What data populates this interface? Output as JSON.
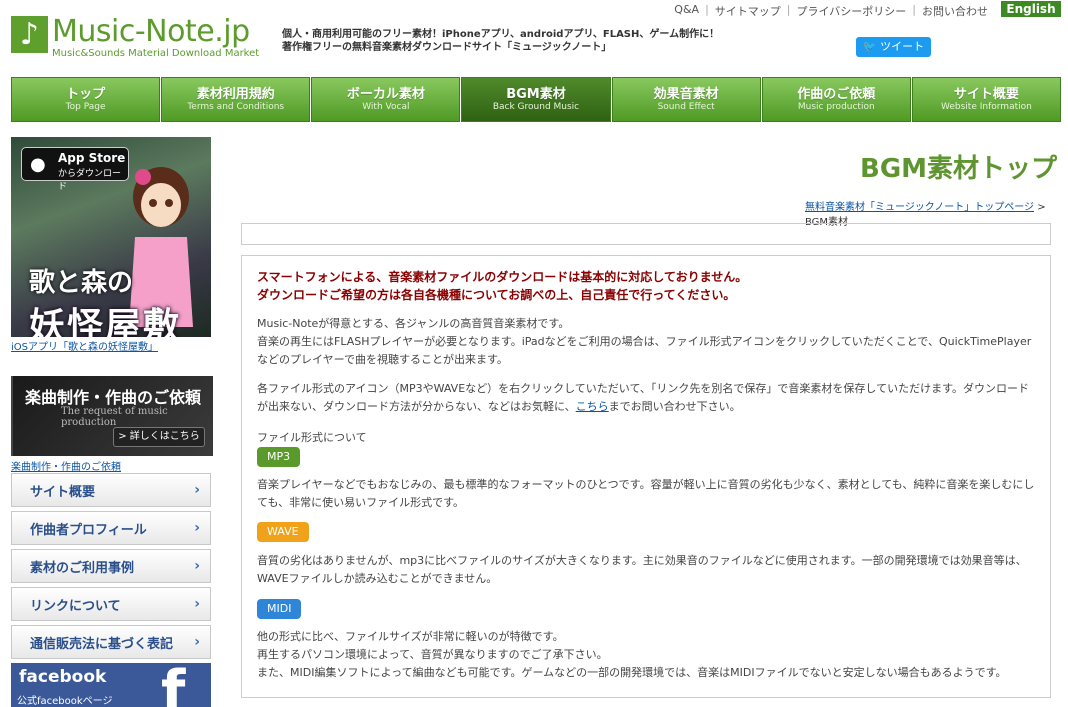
{
  "header": {
    "logo_mark": "♪",
    "logo_title": "Music-Note.jp",
    "logo_sub": "Music&Sounds Material Download Market",
    "tagline1": "個人・商用利用可能のフリー素材！iPhoneアプリ、androidアプリ、FLASH、ゲーム制作に！",
    "tagline2": "著作権フリーの無料音楽素材ダウンロードサイト「ミュージックノート」",
    "top_links": [
      "Q&A",
      "サイトマップ",
      "プライバシーポリシー",
      "お問い合わせ"
    ],
    "lang": "English",
    "tweet": "ツイート"
  },
  "nav": [
    {
      "label": "トップ",
      "sub": "Top Page"
    },
    {
      "label": "素材利用規約",
      "sub": "Terms and Conditions"
    },
    {
      "label": "ボーカル素材",
      "sub": "With Vocal"
    },
    {
      "label": "BGM素材",
      "sub": "Back Ground Music"
    },
    {
      "label": "効果音素材",
      "sub": "Sound Effect"
    },
    {
      "label": "作曲のご依頼",
      "sub": "Music production"
    },
    {
      "label": "サイト概要",
      "sub": "Website Information"
    }
  ],
  "sidebar": {
    "appstore_title": "App Store",
    "appstore_sub": "からダウンロード",
    "game_title_top": "歌と森の",
    "game_title_main": "妖怪屋敷",
    "promo1_link": "iOSアプリ「歌と森の妖怪屋敷」",
    "promo2_title": "楽曲制作・作曲のご依頼",
    "promo2_sub": "The request of music production",
    "promo2_btn": "> 詳しくはこちら",
    "promo2_link": "楽曲制作・作曲のご依頼",
    "menu": [
      "サイト概要",
      "作曲者プロフィール",
      "素材のご利用事例",
      "リンクについて",
      "通信販売法に基づく表記"
    ],
    "facebook_title": "facebook",
    "facebook_sub": "公式facebookページ"
  },
  "main": {
    "title": "BGM素材トップ",
    "breadcrumb_link": "無料音楽素材「ミュージックノート」トップページ",
    "breadcrumb_current": "> BGM素材",
    "warning1": "スマートフォンによる、音楽素材ファイルのダウンロードは基本的に対応しておりません。",
    "warning2": "ダウンロードご希望の方は各自各機種についてお調べの上、自己責任で行ってください。",
    "intro1": "Music-Noteが得意とする、各ジャンルの高音質音楽素材です。",
    "intro2": "音楽の再生にはFLASHプレイヤーが必要となります。iPadなどをご利用の場合は、ファイル形式アイコンをクリックしていただくことで、QuickTimePlayerなどのプレイヤーで曲を視聴することが出来ます。",
    "save_text_a": "各ファイル形式のアイコン（MP3やWAVEなど）を右クリックしていただいて、「リンク先を別名で保存」で音楽素材を保存していただけます。ダウンロードが出来ない、ダウンロード方法が分からない、などはお気軽に、",
    "save_link": "こちら",
    "save_text_b": "までお問い合わせ下さい。",
    "format_heading": "ファイル形式について",
    "mp3_label": "MP3",
    "mp3_desc": "音楽プレイヤーなどでもおなじみの、最も標準的なフォーマットのひとつです。容量が軽い上に音質の劣化も少なく、素材としても、純粋に音楽を楽しむにしても、非常に使い易いファイル形式です。",
    "wave_label": "WAVE",
    "wave_desc": "音質の劣化はありませんが、mp3に比べファイルのサイズが大きくなります。主に効果音のファイルなどに使用されます。一部の開発環境では効果音等は、WAVEファイルしか読み込むことができません。",
    "midi_label": "MIDI",
    "midi_desc1": "他の形式に比べ、ファイルサイズが非常に軽いのが特徴です。",
    "midi_desc2": "再生するパソコン環境によって、音質が異なりますのでご了承下さい。",
    "midi_desc3": "また、MIDI編集ソフトによって編曲なども可能です。ゲームなどの一部の開発環境では、音楽はMIDIファイルでないと安定しない場合もあるようです。"
  },
  "colors": {
    "green": "#5f9530",
    "mp3": "#5a9a2a",
    "wave": "#f0a21a",
    "midi": "#2f86d8",
    "warning": "#8b0000"
  }
}
